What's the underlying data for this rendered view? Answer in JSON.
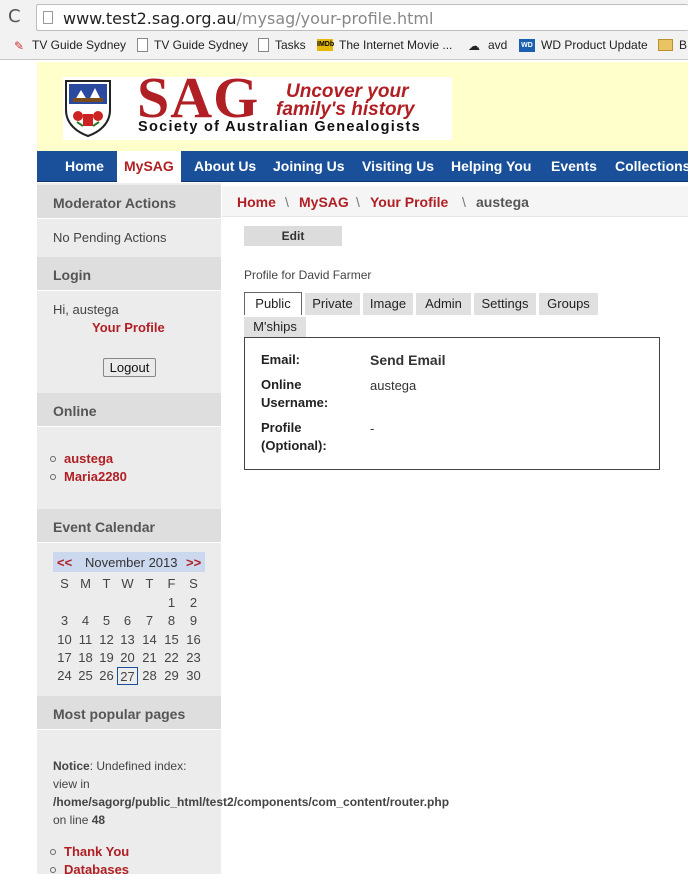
{
  "browser": {
    "url_domain": "www.test2.sag.org.au",
    "url_path": "/mysag/your-profile.html",
    "bookmarks": [
      "TV Guide Sydney",
      "TV Guide Sydney",
      "Tasks",
      "The Internet Movie ...",
      "avd",
      "WD Product Update",
      "BI"
    ]
  },
  "header": {
    "logo": "SAG",
    "tagline_1": "Uncover your",
    "tagline_2": "family's history",
    "society": "Society of Australian Genealogists"
  },
  "nav": [
    "Home",
    "MySAG",
    "About Us",
    "Joining Us",
    "Visiting Us",
    "Helping You",
    "Events",
    "Collections"
  ],
  "sidebar": {
    "moderator_heading": "Moderator Actions",
    "moderator_text": "No Pending Actions",
    "login_heading": "Login",
    "greeting": "Hi, austega",
    "your_profile": "Your Profile",
    "logout": "Logout",
    "online_heading": "Online",
    "online_users": [
      "austega",
      "Maria2280"
    ],
    "calendar_heading": "Event Calendar",
    "calendar": {
      "prev": "<<",
      "title": "November 2013",
      "next": ">>",
      "weekdays": [
        "S",
        "M",
        "T",
        "W",
        "T",
        "F",
        "S"
      ],
      "weeks": [
        [
          "",
          "",
          "",
          "",
          "",
          "1",
          "2"
        ],
        [
          "3",
          "4",
          "5",
          "6",
          "7",
          "8",
          "9"
        ],
        [
          "10",
          "11",
          "12",
          "13",
          "14",
          "15",
          "16"
        ],
        [
          "17",
          "18",
          "19",
          "20",
          "21",
          "22",
          "23"
        ],
        [
          "24",
          "25",
          "26",
          "27",
          "28",
          "29",
          "30"
        ]
      ],
      "today": "27"
    },
    "popular_heading": "Most popular pages",
    "notice_label": "Notice",
    "notice_text_1": ": Undefined index:",
    "notice_text_2": "view in",
    "notice_path": "/home/sagorg/public_html/test2/components/com_content/router.php",
    "notice_line_label": "on line",
    "notice_line": "48",
    "popular_items": [
      "Thank You",
      "Databases"
    ]
  },
  "breadcrumb": {
    "items": [
      "Home",
      "MySAG",
      "Your Profile",
      "austega"
    ],
    "separator": "\\"
  },
  "main": {
    "edit_button": "Edit",
    "profile_title": "Profile for David Farmer",
    "tabs": [
      "Public",
      "Private",
      "Image",
      "Admin",
      "Settings",
      "Groups",
      "M'ships"
    ],
    "fields": [
      {
        "label_1": "Email:",
        "label_2": "",
        "value": "Send Email"
      },
      {
        "label_1": "Online",
        "label_2": "Username:",
        "value": "austega"
      },
      {
        "label_1": "Profile",
        "label_2": "(Optional):",
        "value": "-"
      }
    ]
  },
  "colors": {
    "brand_red": "#b01f24",
    "nav_blue": "#1a4f99",
    "header_bg": "#ffffcc",
    "sidebar_bg": "#ececec"
  }
}
